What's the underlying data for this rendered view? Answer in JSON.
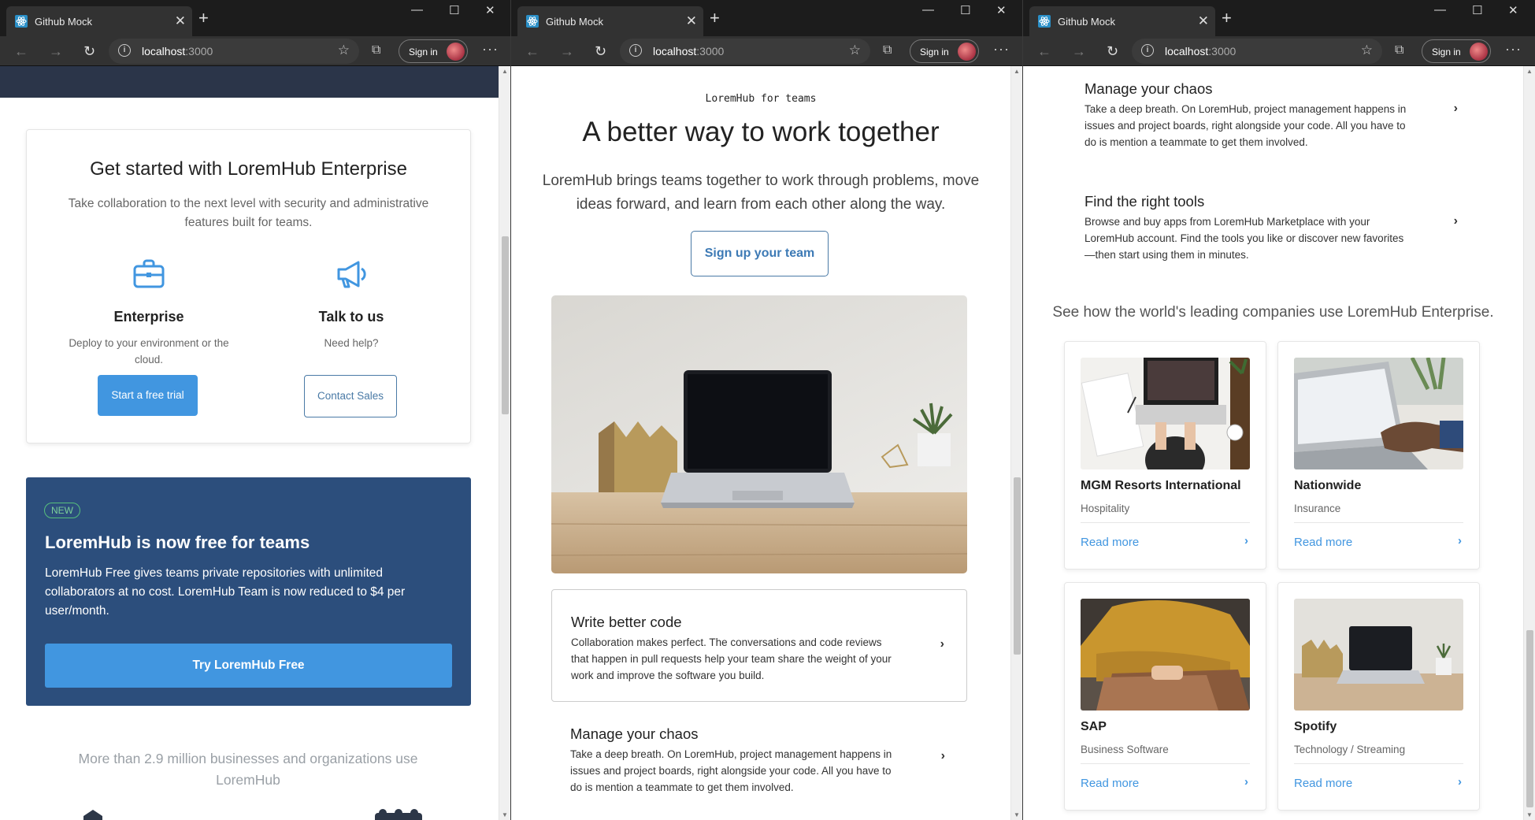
{
  "browser": {
    "tab_title": "Github Mock",
    "tab_close": "✕",
    "new_tab": "+",
    "url_host": "localhost",
    "url_port": ":3000",
    "sign_in": "Sign in",
    "more_menu": "···",
    "minimize": "—",
    "maximize": "☐",
    "close": "✕"
  },
  "window1": {
    "enterprise_card": {
      "title": "Get started with LoremHub Enterprise",
      "lead": "Take collaboration to the next level with security and administrative features built for teams.",
      "enterprise": {
        "title": "Enterprise",
        "desc": "Deploy to your environment or the cloud.",
        "button": "Start a free trial"
      },
      "talk": {
        "title": "Talk to us",
        "desc": "Need help?",
        "button": "Contact Sales"
      }
    },
    "free_card": {
      "badge": "NEW",
      "title": "LoremHub is now free for teams",
      "body": "LoremHub Free gives teams private repositories with unlimited collaborators at no cost. LoremHub Team is now reduced to $4 per user/month.",
      "button": "Try LoremHub Free"
    },
    "businesses": "More than 2.9 million businesses and organizations use LoremHub"
  },
  "window2": {
    "eyebrow": "LoremHub for teams",
    "title": "A better way to work together",
    "lead": "LoremHub brings teams together to work through problems, move ideas forward, and learn from each other along the way.",
    "signup_button": "Sign up your team",
    "features": [
      {
        "title": "Write better code",
        "desc": "Collaboration makes perfect. The conversations and code reviews that happen in pull requests help your team share the weight of your work and improve the software you build."
      },
      {
        "title": "Manage your chaos",
        "desc": "Take a deep breath. On LoremHub, project management happens in issues and project boards, right alongside your code. All you have to do is mention a teammate to get them involved."
      }
    ],
    "chevron": "›"
  },
  "window3": {
    "features": [
      {
        "title": "Manage your chaos",
        "desc": "Take a deep breath. On LoremHub, project management happens in issues and project boards, right alongside your code. All you have to do is mention a teammate to get them involved."
      },
      {
        "title": "Find the right tools",
        "desc": "Browse and buy apps from LoremHub Marketplace with your LoremHub account. Find the tools you like or discover new favorites —then start using them in minutes."
      }
    ],
    "companies_heading": "See how the world's leading companies use LoremHub Enterprise.",
    "companies": [
      {
        "name": "MGM Resorts International",
        "industry": "Hospitality",
        "link": "Read more"
      },
      {
        "name": "Nationwide",
        "industry": "Insurance",
        "link": "Read more"
      },
      {
        "name": "SAP",
        "industry": "Business Software",
        "link": "Read more"
      },
      {
        "name": "Spotify",
        "industry": "Technology / Streaming",
        "link": "Read more"
      }
    ],
    "chevron": "›"
  },
  "colors": {
    "accent": "#4196e0",
    "dark_card": "#2c4e7c",
    "chrome": "#323232",
    "new_badge": "#57c07c"
  }
}
